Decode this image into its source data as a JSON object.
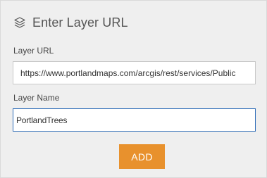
{
  "dialog": {
    "title": "Enter Layer URL",
    "icon": "layers-icon"
  },
  "form": {
    "url_label": "Layer URL",
    "url_value": "https://www.portlandmaps.com/arcgis/rest/services/Public",
    "name_label": "Layer Name",
    "name_value": "PortlandTrees"
  },
  "actions": {
    "add_label": "ADD"
  },
  "colors": {
    "accent": "#e8912d",
    "focus_border": "#2f6db8",
    "panel_background": "#efefef"
  }
}
